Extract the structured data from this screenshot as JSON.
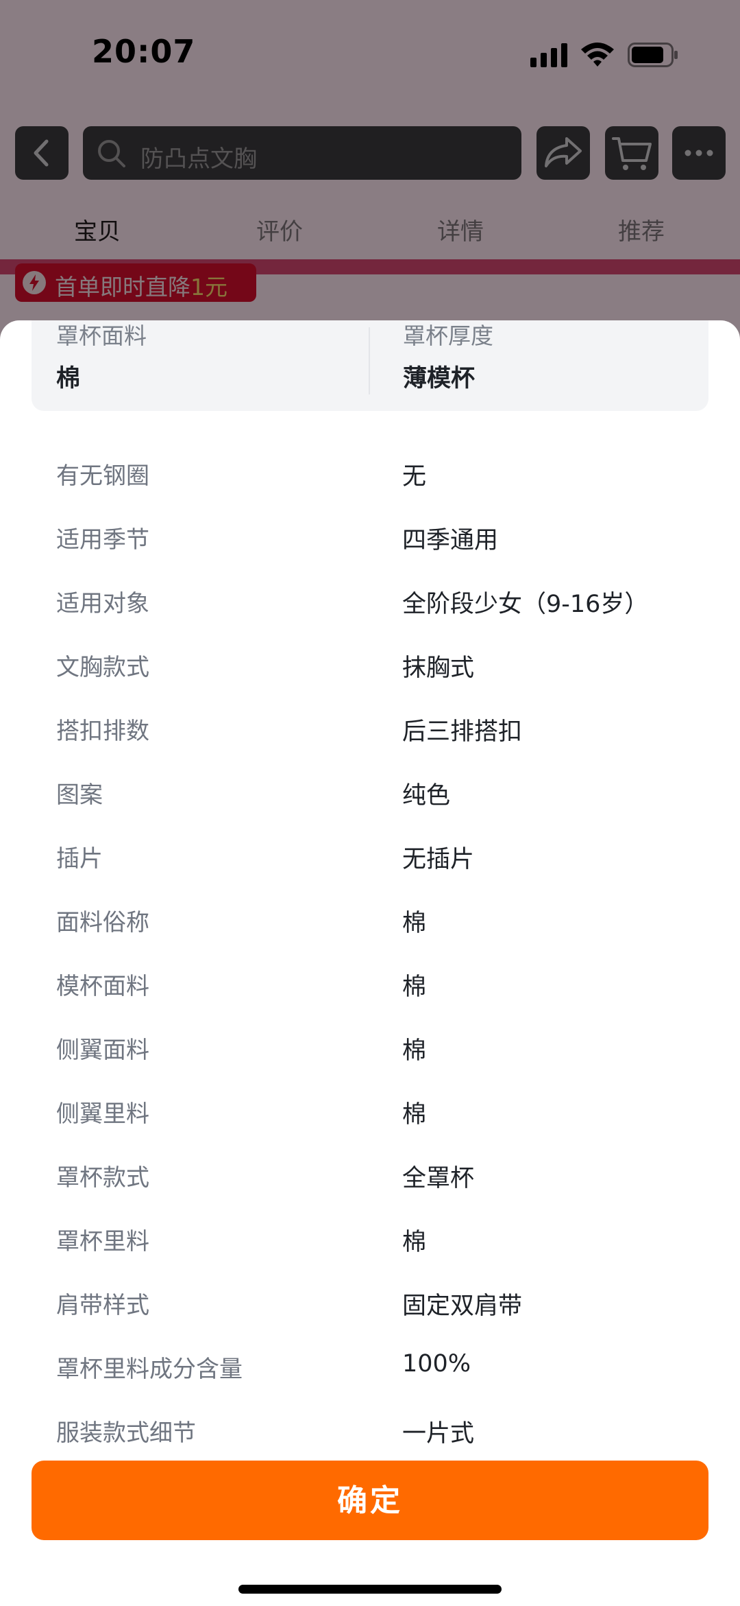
{
  "status_bar": {
    "time": "20:07"
  },
  "search": {
    "query": "防凸点文胸"
  },
  "tabs": [
    {
      "label": "宝贝"
    },
    {
      "label": "评价"
    },
    {
      "label": "详情"
    },
    {
      "label": "推荐"
    }
  ],
  "promo": {
    "text": "首单即时直降",
    "amount": "1元"
  },
  "highlights": [
    {
      "label": "罩杯面料",
      "value": "棉"
    },
    {
      "label": "罩杯厚度",
      "value": "薄模杯"
    }
  ],
  "specs": [
    {
      "label": "有无钢圈",
      "value": "无"
    },
    {
      "label": "适用季节",
      "value": "四季通用"
    },
    {
      "label": "适用对象",
      "value": "全阶段少女（9-16岁）"
    },
    {
      "label": "文胸款式",
      "value": "抹胸式"
    },
    {
      "label": "搭扣排数",
      "value": "后三排搭扣"
    },
    {
      "label": "图案",
      "value": "纯色"
    },
    {
      "label": "插片",
      "value": "无插片"
    },
    {
      "label": "面料俗称",
      "value": "棉"
    },
    {
      "label": "模杯面料",
      "value": "棉"
    },
    {
      "label": "侧翼面料",
      "value": "棉"
    },
    {
      "label": "侧翼里料",
      "value": "棉"
    },
    {
      "label": "罩杯款式",
      "value": "全罩杯"
    },
    {
      "label": "罩杯里料",
      "value": "棉"
    },
    {
      "label": "肩带样式",
      "value": "固定双肩带"
    },
    {
      "label": "罩杯里料成分含量",
      "value": "100%"
    },
    {
      "label": "服装款式细节",
      "value": "一片式"
    }
  ],
  "confirm": {
    "label": "确定"
  },
  "colors": {
    "accent": "#ff6a00",
    "promo_red": "#d40d2c"
  }
}
